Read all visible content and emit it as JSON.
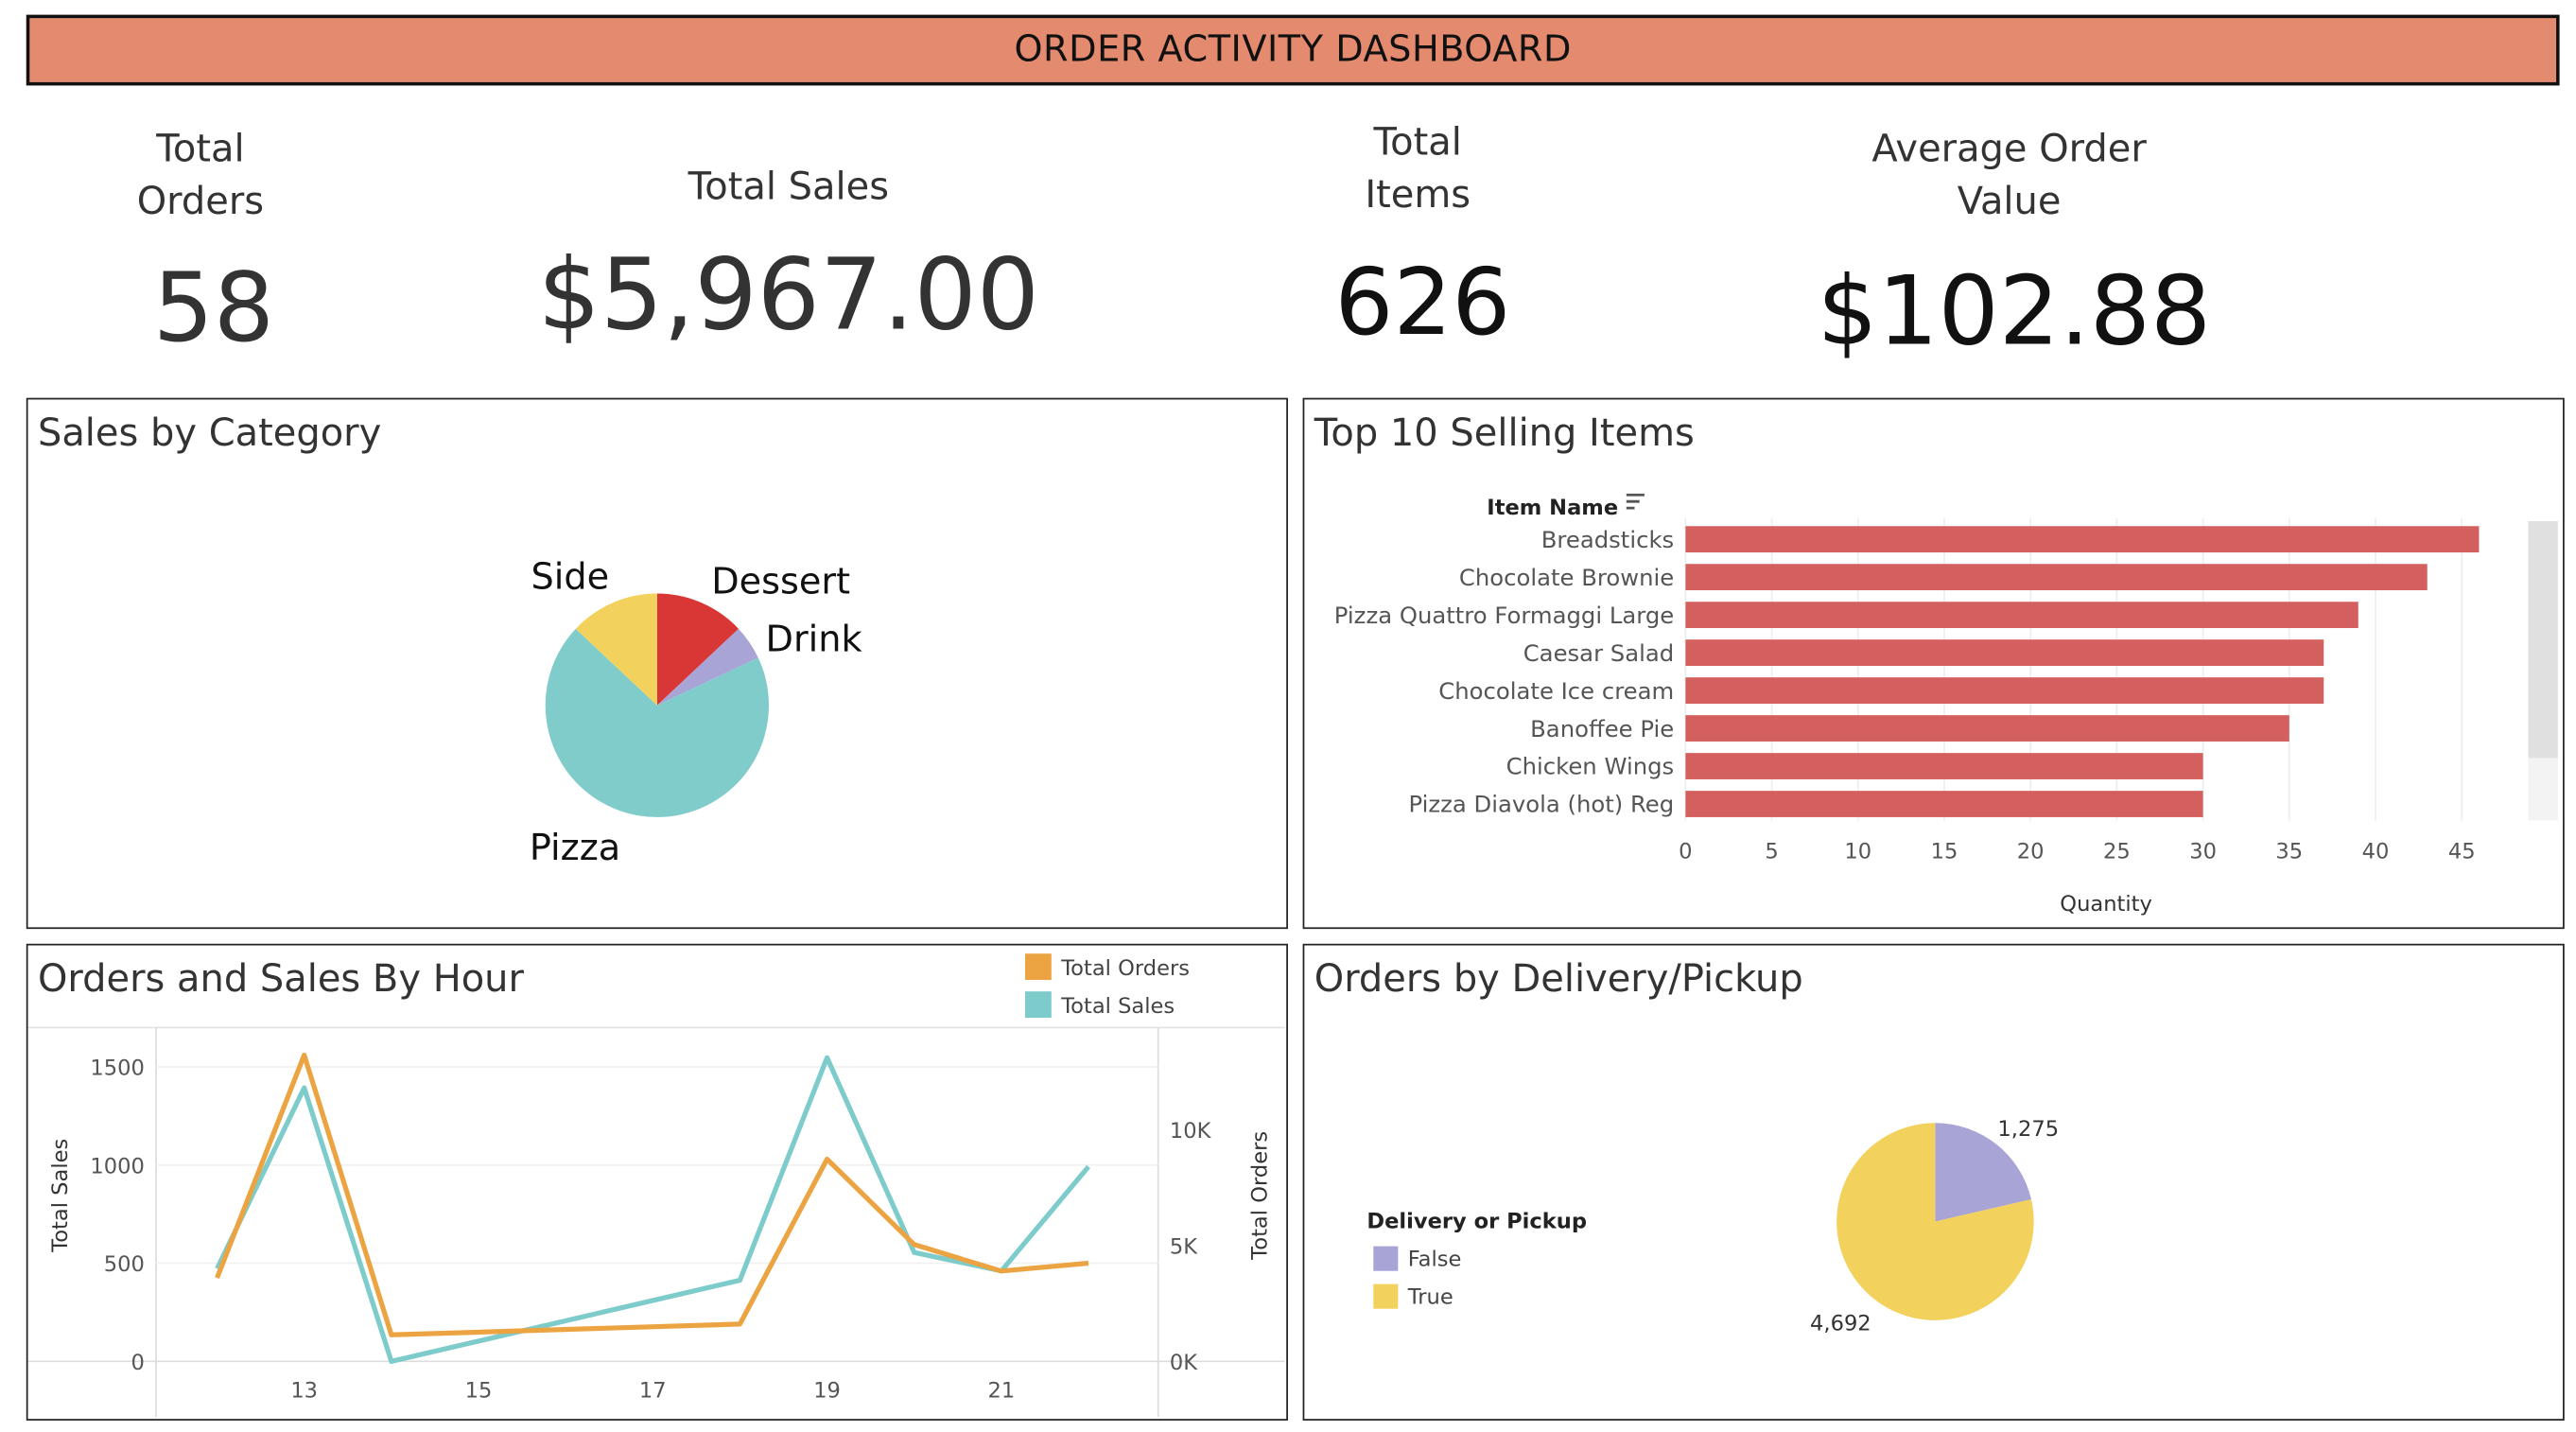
{
  "header": {
    "title": "ORDER ACTIVITY DASHBOARD"
  },
  "kpis": {
    "total_orders": {
      "label_line1": "Total",
      "label_line2": "Orders",
      "value": "58"
    },
    "total_sales": {
      "label": "Total Sales",
      "value": "$5,967.00"
    },
    "total_items": {
      "label_line1": "Total",
      "label_line2": "Items",
      "value": "626"
    },
    "avg_order_value": {
      "label_line1": "Average Order",
      "label_line2": "Value",
      "value": "$102.88"
    }
  },
  "panels": {
    "category": {
      "title": "Sales by Category"
    },
    "top_items": {
      "title": "Top 10 Selling Items",
      "dim_header": "Item Name"
    },
    "hourly": {
      "title": "Orders and Sales By Hour"
    },
    "delivery": {
      "title": "Orders by Delivery/Pickup"
    }
  },
  "colors": {
    "header": "#e38a6f",
    "bar": "#d45f5f",
    "orders_line": "#eca443",
    "sales_line": "#7ecbcb",
    "pizza": "#80cccb",
    "side": "#f2d15c",
    "dessert": "#d93636",
    "drink": "#a8a4d6",
    "false": "#a8a4d6",
    "true": "#f2d15c"
  },
  "chart_data": [
    {
      "type": "pie",
      "title": "Sales by Category",
      "slices": [
        {
          "label": "Dessert",
          "value": 13,
          "color": "#d93636"
        },
        {
          "label": "Drink",
          "value": 5,
          "color": "#a8a4d6"
        },
        {
          "label": "Pizza",
          "value": 69,
          "color": "#80cccb"
        },
        {
          "label": "Side",
          "value": 13,
          "color": "#f2d15c"
        }
      ]
    },
    {
      "type": "bar",
      "orientation": "horizontal",
      "title": "Top 10 Selling Items",
      "categories_header": "Item Name",
      "categories": [
        "Breadsticks",
        "Chocolate Brownie",
        "Pizza Quattro Formaggi Large",
        "Caesar Salad",
        "Chocolate Ice cream",
        "Banoffee Pie",
        "Chicken Wings",
        "Pizza Diavola (hot) Reg"
      ],
      "values": [
        46,
        43,
        39,
        37,
        37,
        35,
        30,
        30
      ],
      "xlabel": "Quantity",
      "xlim": [
        0,
        48
      ],
      "xticks": [
        "0",
        "5",
        "10",
        "15",
        "20",
        "25",
        "30",
        "35",
        "40",
        "45"
      ]
    },
    {
      "type": "line",
      "title": "Orders and Sales By Hour",
      "x": [
        12,
        13,
        14,
        18,
        19,
        20,
        21,
        22
      ],
      "xticks": [
        "13",
        "15",
        "17",
        "19",
        "21"
      ],
      "series": [
        {
          "name": "Total Orders",
          "axis": "left",
          "values": [
            425,
            1560,
            135,
            190,
            1030,
            595,
            460,
            500
          ],
          "color": "#eca443"
        },
        {
          "name": "Total Sales",
          "axis": "right",
          "values": [
            4000,
            11800,
            0,
            3500,
            13100,
            4700,
            3900,
            8400
          ],
          "color": "#7ecbcb"
        }
      ],
      "ylabel_left": "Total Sales",
      "ylabel_right": "Total Orders",
      "ylim_left": [
        0,
        1700
      ],
      "ylim_right": [
        0,
        14400
      ],
      "yticks_left": [
        "0",
        "500",
        "1000",
        "1500"
      ],
      "yticks_right": [
        "0K",
        "5K",
        "10K"
      ],
      "legend": [
        "Total Orders",
        "Total Sales"
      ],
      "legend_position": "top-right"
    },
    {
      "type": "pie",
      "title": "Orders by Delivery/Pickup",
      "legend_title": "Delivery or Pickup",
      "slices": [
        {
          "label": "False",
          "value": 1275,
          "display": "1,275",
          "color": "#a8a4d6"
        },
        {
          "label": "True",
          "value": 4692,
          "display": "4,692",
          "color": "#f2d15c"
        }
      ]
    }
  ]
}
